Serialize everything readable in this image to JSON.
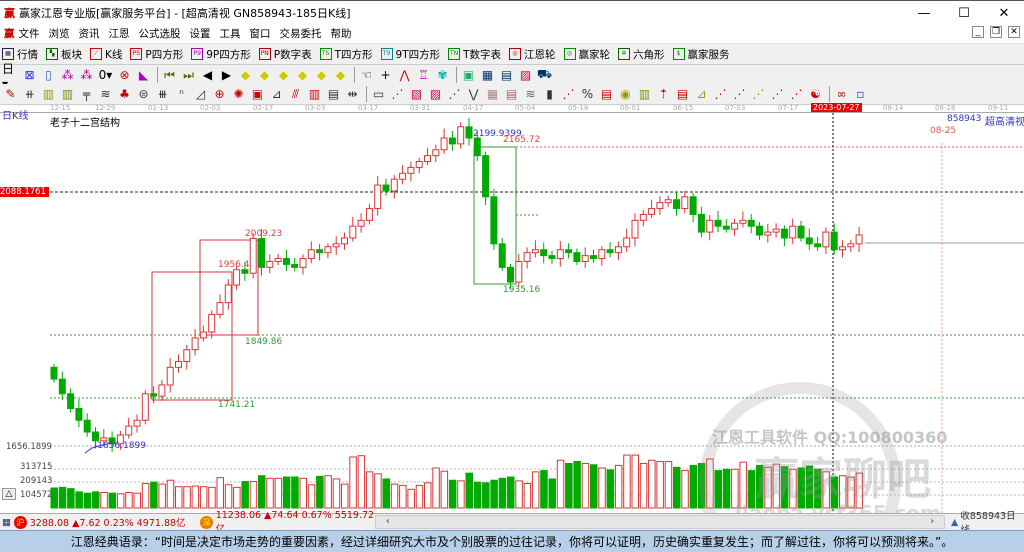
{
  "window": {
    "logo": "赢",
    "title": "赢家江恩专业版[赢家服务平台] - [超高清视  GN858943-185日K线]",
    "minimize": "—",
    "maximize": "☐",
    "close": "✕"
  },
  "menu": [
    "文件",
    "浏览",
    "资讯",
    "江恩",
    "公式选股",
    "设置",
    "工具",
    "窗口",
    "交易委托",
    "帮助"
  ],
  "toolbar1": [
    {
      "label": "行情",
      "icon": "▦",
      "color": "#225"
    },
    {
      "label": "板块",
      "icon": "▚",
      "color": "#060"
    },
    {
      "label": "K线",
      "icon": "⟋",
      "color": "#c00"
    },
    {
      "label": "P四方形",
      "icon": "PS",
      "color": "#c00"
    },
    {
      "label": "9P四方形",
      "icon": "P9",
      "color": "#a0a"
    },
    {
      "label": "P数字表",
      "icon": "PN",
      "color": "#a00"
    },
    {
      "label": "T四方形",
      "icon": "TS",
      "color": "#080"
    },
    {
      "label": "9T四方形",
      "icon": "T9",
      "color": "#088"
    },
    {
      "label": "T数字表",
      "icon": "TN",
      "color": "#080"
    },
    {
      "label": "江恩轮",
      "icon": "◎",
      "color": "#a00"
    },
    {
      "label": "赢家轮",
      "icon": "◎",
      "color": "#080"
    },
    {
      "label": "六角形",
      "icon": "✡",
      "color": "#060"
    },
    {
      "label": "赢家服务",
      "icon": "$",
      "color": "#080"
    }
  ],
  "toolbar2": [
    {
      "name": "period-day",
      "glyph": "日▾",
      "color": "#000"
    },
    {
      "name": "chart-type",
      "glyph": "⊠",
      "color": "#33c"
    },
    {
      "name": "doc",
      "glyph": "▯",
      "color": "#36a"
    },
    {
      "name": "indicator-a",
      "glyph": "⁂",
      "color": "#a0a"
    },
    {
      "name": "indicator-b",
      "glyph": "⁂",
      "color": "#a0a"
    },
    {
      "name": "bar-type",
      "glyph": "0▾",
      "color": "#000"
    },
    {
      "name": "cross-out",
      "glyph": "⊗",
      "color": "#c00"
    },
    {
      "name": "flag",
      "glyph": "◣",
      "color": "#a0c"
    },
    {
      "name": "first",
      "glyph": "⏮",
      "color": "#660"
    },
    {
      "name": "last",
      "glyph": "⏭",
      "color": "#660"
    },
    {
      "name": "prev",
      "glyph": "◀",
      "color": "#000"
    },
    {
      "name": "next",
      "glyph": "▶",
      "color": "#000"
    },
    {
      "name": "zoom-1",
      "glyph": "◆",
      "color": "#cc0"
    },
    {
      "name": "zoom-2",
      "glyph": "◆",
      "color": "#cc0"
    },
    {
      "name": "zoom-3",
      "glyph": "◆",
      "color": "#cc0"
    },
    {
      "name": "zoom-4",
      "glyph": "◆",
      "color": "#cc0"
    },
    {
      "name": "zoom-5",
      "glyph": "◆",
      "color": "#cc0"
    },
    {
      "name": "zoom-6",
      "glyph": "◆",
      "color": "#cc0"
    },
    {
      "name": "hand",
      "glyph": "☜",
      "color": "#000"
    },
    {
      "name": "crosshair",
      "glyph": "+",
      "color": "#000"
    },
    {
      "name": "trend",
      "glyph": "⋀",
      "color": "#c00"
    },
    {
      "name": "shirt",
      "glyph": "♖",
      "color": "#a0a"
    },
    {
      "name": "globe",
      "glyph": "✾",
      "color": "#0aa"
    },
    {
      "name": "calendar",
      "glyph": "▣",
      "color": "#2a6"
    },
    {
      "name": "calculator",
      "glyph": "▦",
      "color": "#036"
    },
    {
      "name": "notes",
      "glyph": "▤",
      "color": "#036"
    },
    {
      "name": "save",
      "glyph": "▨",
      "color": "#c03"
    },
    {
      "name": "trade",
      "glyph": "⛟",
      "color": "#036"
    }
  ],
  "toolbar3": [
    "pen",
    "hash",
    "gold-a",
    "gold-b",
    "fork",
    "spiral",
    "bell",
    "circle-grid",
    "lines",
    "n2",
    "angle",
    "target",
    "star",
    "box-x",
    "slash",
    "fan-a",
    "fan-b",
    "grid",
    "span",
    "box",
    "fan-c",
    "fan-d",
    "fan-e",
    "pen-b",
    "v",
    "grid-b",
    "grid-c",
    "stripes",
    "col",
    "percent-fan",
    "percent",
    "gold-c",
    "gold-coin",
    "gold-d",
    "arrow",
    "gold-e",
    "gold-f",
    "angle-a",
    "angle-b",
    "angle-c",
    "angle-d",
    "angle-e",
    "angle-f",
    "yinyang",
    "infinity"
  ],
  "date_axis": {
    "ticks": [
      "12-15",
      "12-29",
      "01-13",
      "02-03",
      "02-17",
      "03-03",
      "03-17",
      "03-31",
      "04-17",
      "05-04",
      "05-18",
      "06-01",
      "06-15",
      "07-03",
      "07-17",
      "08-14",
      "08-28",
      "09-11"
    ],
    "cursor_date": "2023-07-27"
  },
  "chart": {
    "period_label": "日K线",
    "structure_title": "老子十二宫结构",
    "code_label": "858943",
    "mode_label": "超高清视",
    "future_date": "08-25",
    "cursor_price": "2088.1761",
    "low_price_axis": "1656.1899",
    "annotations": {
      "high": "2199.9399",
      "level_red": "2165.72",
      "box_top": "2009.23",
      "partial": "1956.4",
      "mid": "1849.86",
      "low_box": "1741.21",
      "pullback": "1935.16",
      "low": "-1656.1899"
    },
    "volume_ticks": [
      "313715",
      "209143",
      "104572"
    ],
    "watermark_1": "江恩工具软件  QQ:100800360",
    "watermark_2": "赢家聊吧",
    "watermark_3": "liaoba.ycf365.com"
  },
  "chart_data": {
    "type": "candlestick",
    "title": "GN858943 日K线",
    "ylim": [
      1640,
      2215
    ],
    "closes": [
      1770,
      1745,
      1720,
      1700,
      1680,
      1665,
      1670,
      1660,
      1675,
      1690,
      1700,
      1745,
      1741,
      1760,
      1790,
      1800,
      1820,
      1840,
      1850,
      1880,
      1900,
      1930,
      1956,
      1950,
      2009,
      1960,
      1970,
      1975,
      1965,
      1960,
      1975,
      1990,
      1985,
      1995,
      2000,
      2010,
      2030,
      2040,
      2060,
      2100,
      2090,
      2110,
      2120,
      2130,
      2140,
      2150,
      2160,
      2180,
      2170,
      2199,
      2180,
      2150,
      2080,
      2000,
      1960,
      1935,
      1970,
      1985,
      1990,
      1980,
      1975,
      1990,
      1985,
      1970,
      1980,
      1975,
      1990,
      1985,
      1995,
      2010,
      2040,
      2050,
      2060,
      2070,
      2075,
      2060,
      2080,
      2050,
      2020,
      2040,
      2030,
      2025,
      2035,
      2040,
      2030,
      2015,
      2020,
      2025,
      2010,
      2030,
      2010,
      2000,
      1995,
      2020,
      1990,
      1995,
      2000,
      2015
    ],
    "volumes": [
      155000,
      160000,
      150000,
      125000,
      115000,
      125000,
      120000,
      115000,
      110000,
      120000,
      115000,
      190000,
      200000,
      185000,
      215000,
      165000,
      165000,
      170000,
      165000,
      160000,
      235000,
      180000,
      160000,
      205000,
      205000,
      250000,
      230000,
      230000,
      240000,
      240000,
      230000,
      180000,
      245000,
      250000,
      225000,
      185000,
      395000,
      405000,
      280000,
      265000,
      225000,
      185000,
      175000,
      145000,
      175000,
      195000,
      310000,
      285000,
      215000,
      210000,
      270000,
      200000,
      195000,
      215000,
      230000,
      240000,
      210000,
      190000,
      280000,
      290000,
      225000,
      370000,
      345000,
      360000,
      345000,
      335000,
      310000,
      295000,
      330000,
      410000,
      410000,
      345000,
      370000,
      360000,
      360000,
      315000,
      290000,
      330000,
      345000,
      380000,
      290000,
      300000,
      300000,
      355000,
      290000,
      330000,
      315000,
      340000,
      320000,
      300000,
      310000,
      325000,
      300000,
      280000,
      240000,
      250000,
      240000,
      270000
    ]
  },
  "status": {
    "sh_icon": "沪",
    "sh": "3288.08 ▲7.62 0.23% 4971.88亿",
    "sz_icon": "深",
    "sz": "11238.06 ▲74.64 0.67% 5519.72亿",
    "right": "收858943日线"
  },
  "quote": "江恩经典语录：“时间是决定市场走势的重要因素，经过详细研究大市及个别股票的过往记录，你将可以证明，历史确实重复发生；而了解过往，你将可以预测将来。”。"
}
